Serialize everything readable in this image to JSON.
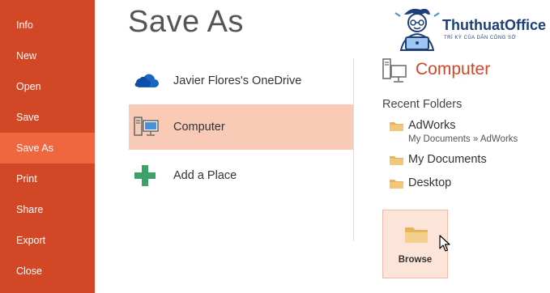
{
  "sidebar": {
    "items": [
      {
        "label": "Info"
      },
      {
        "label": "New"
      },
      {
        "label": "Open"
      },
      {
        "label": "Save"
      },
      {
        "label": "Save As",
        "active": true
      },
      {
        "label": "Print"
      },
      {
        "label": "Share"
      },
      {
        "label": "Export"
      },
      {
        "label": "Close"
      }
    ]
  },
  "page": {
    "title": "Save As"
  },
  "places": [
    {
      "label": "Javier Flores's OneDrive",
      "icon": "cloud-icon"
    },
    {
      "label": "Computer",
      "icon": "computer-icon",
      "selected": true
    },
    {
      "label": "Add a Place",
      "icon": "plus-icon"
    }
  ],
  "right_pane": {
    "heading": "Computer",
    "recent_title": "Recent Folders",
    "folders": [
      {
        "name": "AdWorks",
        "path": "My Documents » AdWorks"
      },
      {
        "name": "My Documents"
      },
      {
        "name": "Desktop"
      }
    ],
    "browse_label": "Browse"
  },
  "logo": {
    "brand": "ThuthuatOffice",
    "tagline": "TRÍ KỲ CỦA DÂN CÔNG SỞ"
  },
  "colors": {
    "sidebar": "#d24726",
    "sidebar_active": "#f0663f",
    "selected_place": "#f9cbb6",
    "accent_text": "#d24726",
    "browse_bg": "#fde4d9"
  }
}
